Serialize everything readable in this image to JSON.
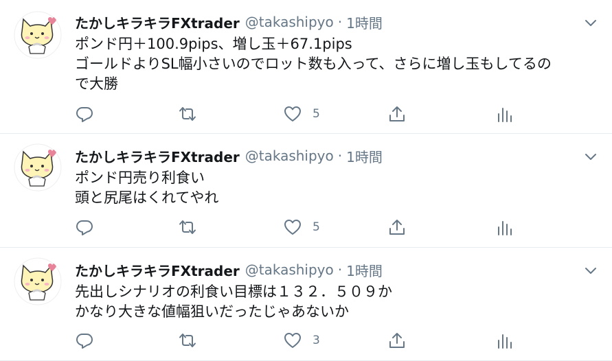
{
  "tweets": [
    {
      "name": "たかしキラキラFXtrader",
      "handle": "@takashipyo",
      "separator": "·",
      "time": "1時間",
      "text": "ポンド円＋100.9pips、増し玉＋67.1pips\nゴールドよりSL幅小さいのでロット数も入って、さらに増し玉もしてるの\nで大勝",
      "likes": "5"
    },
    {
      "name": "たかしキラキラFXtrader",
      "handle": "@takashipyo",
      "separator": "·",
      "time": "1時間",
      "text": "ポンド円売り利食い\n頭と尻尾はくれてやれ",
      "likes": "5"
    },
    {
      "name": "たかしキラキラFXtrader",
      "handle": "@takashipyo",
      "separator": "·",
      "time": "1時間",
      "text": "先出しシナリオの利食い目標は１３２．５０９か\nかなり大きな値幅狙いだったじゃあないか",
      "likes": "3"
    }
  ],
  "icons": {
    "reply": "reply-icon",
    "retweet": "retweet-icon",
    "like": "heart-icon",
    "share": "share-icon",
    "analytics": "analytics-icon",
    "caret": "chevron-down-icon",
    "avatar": "cat-avatar"
  },
  "colors": {
    "text": "#14171a",
    "secondary": "#657786",
    "divider": "#e6ecf0",
    "avatar_heart": "#e8849a",
    "avatar_cat": "#fff4b8"
  }
}
